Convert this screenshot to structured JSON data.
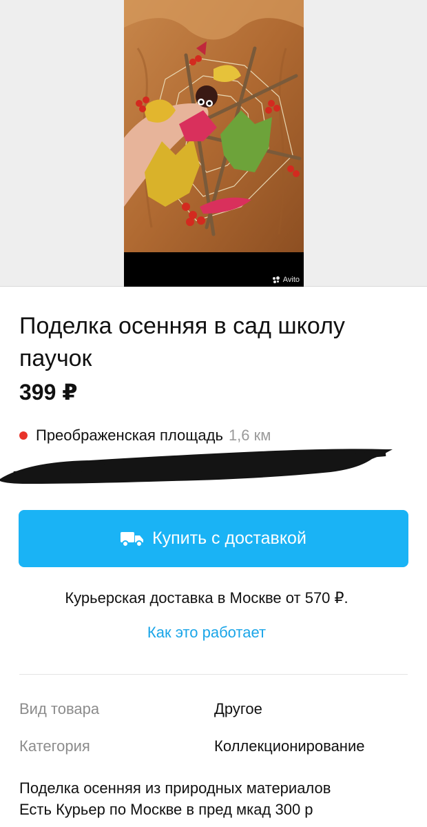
{
  "gallery": {
    "watermark": "Avito",
    "image_alt": "Поделка осенняя паучок"
  },
  "listing": {
    "title": "Поделка осенняя в сад школу паучок",
    "price": "399 ₽"
  },
  "location": {
    "metro": "Преображенская площадь",
    "distance": "1,6 км",
    "metro_color": "#e8332a"
  },
  "delivery": {
    "button_label": "Купить с доставкой",
    "note": "Курьерская доставка в Москве от 570 ₽.",
    "how_link": "Как это работает"
  },
  "params": [
    {
      "key": "Вид товара",
      "value": "Другое"
    },
    {
      "key": "Категория",
      "value": "Коллекционирование"
    }
  ],
  "description": {
    "line1": "Поделка осенняя из природных материалов",
    "line2": "Есть Курьер по Москве в пред мкад 300 р"
  },
  "colors": {
    "accent": "#1ab3f5",
    "link": "#1aa5e8",
    "muted": "#8c8c8c"
  }
}
